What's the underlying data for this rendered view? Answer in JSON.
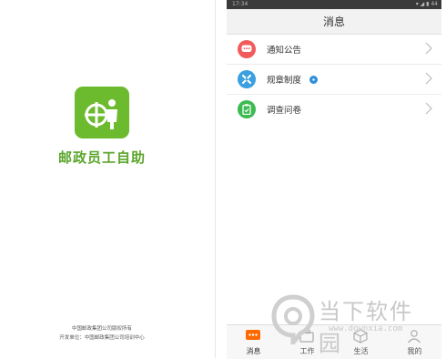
{
  "splash": {
    "app_name": "邮政员工自助",
    "copyright": "中国邮政集团公司版权所有",
    "developer": "开发单位：中国邮政集团公司培训中心",
    "colors": {
      "brand": "#6cba2e"
    }
  },
  "phone": {
    "status_bar": {
      "time": "17:34",
      "right": "▾ ◢ ▮ 44"
    },
    "nav_title": "消息",
    "menu": [
      {
        "label": "通知公告",
        "icon": "chat-bubble-icon",
        "color": "#f25b5b"
      },
      {
        "label": "规章制度",
        "icon": "rules-icon",
        "color": "#3aa0e0",
        "badge": true
      },
      {
        "label": "调查问卷",
        "icon": "clipboard-icon",
        "color": "#3dbb52"
      }
    ],
    "tabs": [
      {
        "label": "消息",
        "icon": "message-icon",
        "active": true
      },
      {
        "label": "工作",
        "icon": "briefcase-icon"
      },
      {
        "label": "生活",
        "icon": "cube-icon"
      },
      {
        "label": "我的",
        "icon": "profile-icon"
      }
    ],
    "colors": {
      "accent": "#ff6a00"
    }
  },
  "watermark": {
    "title": "当下软件园",
    "url": "www.downxia.com"
  }
}
